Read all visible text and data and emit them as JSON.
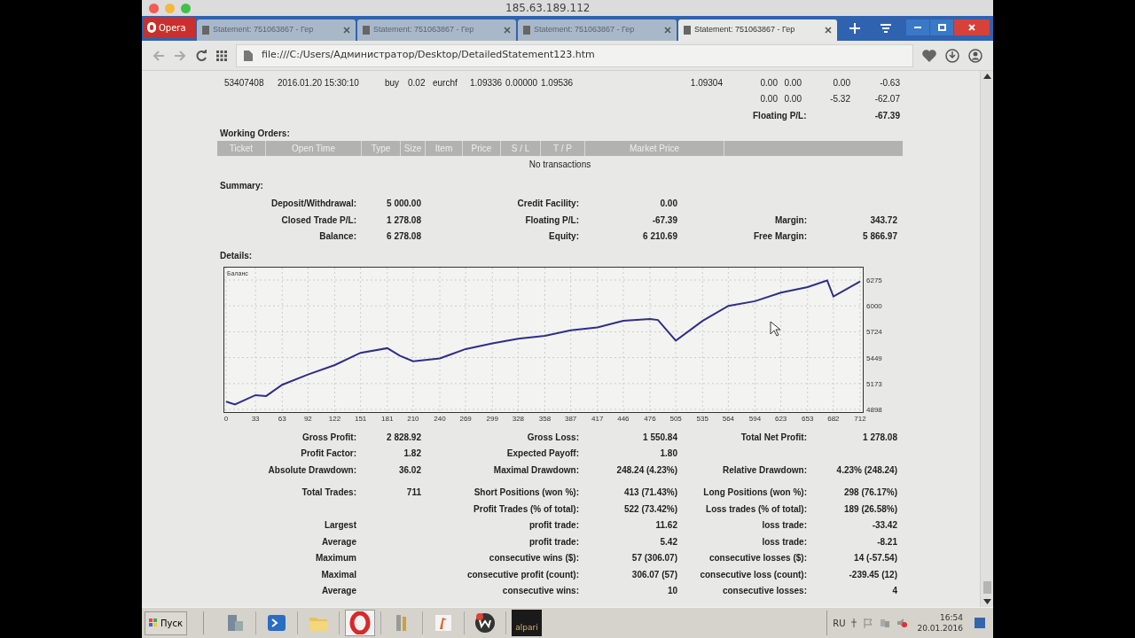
{
  "window": {
    "title": "185.63.189.112"
  },
  "browser": {
    "menu_label": "Opera",
    "tabs": [
      {
        "label": "Statement: 751063867 - Гер",
        "selected": false
      },
      {
        "label": "Statement: 751063867 - Гер",
        "selected": false
      },
      {
        "label": "Statement: 751063867 - Гер",
        "selected": false
      },
      {
        "label": "Statement: 751063867 - Гер",
        "selected": true
      }
    ],
    "address": "file:///C:/Users/Администратор/Desktop/DetailedStatement123.htm"
  },
  "open_trades": {
    "rows": [
      {
        "cells": [
          "53407408",
          "2016.01.20 15:30:10",
          "buy",
          "0.02",
          "eurchf",
          "1.09336",
          "0.00000",
          "1.09536",
          "1.09304",
          "0.00",
          "0.00",
          "0.00",
          "-0.63"
        ]
      }
    ],
    "totals": [
      "0.00",
      "0.00",
      "-5.32",
      "-62.07"
    ],
    "floating_label": "Floating P/L:",
    "floating_value": "-67.39"
  },
  "working_orders": {
    "title": "Working Orders:",
    "columns": [
      "Ticket",
      "Open Time",
      "Type",
      "Size",
      "Item",
      "Price",
      "S / L",
      "T / P",
      "Market Price"
    ],
    "empty_text": "No transactions"
  },
  "summary": {
    "title": "Summary:",
    "rows": [
      [
        {
          "label": "Deposit/Withdrawal:",
          "value": "5 000.00"
        },
        {
          "label": "Credit Facility:",
          "value": "0.00"
        },
        null
      ],
      [
        {
          "label": "Closed Trade P/L:",
          "value": "1 278.08"
        },
        {
          "label": "Floating P/L:",
          "value": "-67.39"
        },
        {
          "label": "Margin:",
          "value": "343.72"
        }
      ],
      [
        {
          "label": "Balance:",
          "value": "6 278.08"
        },
        {
          "label": "Equity:",
          "value": "6 210.69"
        },
        {
          "label": "Free Margin:",
          "value": "5 866.97"
        }
      ]
    ]
  },
  "details": {
    "title": "Details:",
    "chart_data": {
      "type": "line",
      "grid": true,
      "xlim": [
        0,
        712
      ],
      "ylim": [
        4898,
        6275
      ],
      "xticks": [
        0,
        33,
        63,
        92,
        122,
        151,
        181,
        210,
        240,
        269,
        299,
        328,
        358,
        387,
        417,
        446,
        476,
        505,
        535,
        564,
        594,
        623,
        653,
        682,
        712
      ],
      "yticks": [
        4898,
        5173,
        5449,
        5724,
        6000,
        6275
      ],
      "x": [
        0,
        10,
        33,
        45,
        63,
        92,
        122,
        151,
        181,
        195,
        210,
        240,
        269,
        299,
        328,
        358,
        387,
        417,
        446,
        476,
        485,
        505,
        535,
        564,
        594,
        623,
        653,
        675,
        682,
        712
      ],
      "series": [
        {
          "name": "Баланс",
          "color": "#2e2e8a",
          "values": [
            4980,
            4950,
            5050,
            5040,
            5160,
            5270,
            5370,
            5500,
            5550,
            5470,
            5410,
            5440,
            5540,
            5600,
            5650,
            5680,
            5740,
            5770,
            5840,
            5860,
            5850,
            5630,
            5840,
            6000,
            6050,
            6140,
            6200,
            6270,
            6100,
            6260
          ]
        }
      ]
    },
    "stats_groups": [
      {
        "rows": [
          [
            {
              "label": "Gross Profit:",
              "value": "2 828.92"
            },
            {
              "label": "Gross Loss:",
              "value": "1 550.84"
            },
            {
              "label": "Total Net Profit:",
              "value": "1 278.08"
            }
          ],
          [
            {
              "label": "Profit Factor:",
              "value": "1.82"
            },
            {
              "label": "Expected Payoff:",
              "value": "1.80"
            },
            null
          ],
          [
            {
              "label": "Absolute Drawdown:",
              "value": "36.02"
            },
            {
              "label": "Maximal Drawdown:",
              "value": "248.24 (4.23%)"
            },
            {
              "label": "Relative Drawdown:",
              "value": "4.23% (248.24)"
            }
          ]
        ]
      },
      {
        "rows": [
          [
            {
              "label": "Total Trades:",
              "value": "711"
            },
            {
              "label": "Short Positions (won %):",
              "value": "413 (71.43%)"
            },
            {
              "label": "Long Positions (won %):",
              "value": "298 (76.17%)"
            }
          ],
          [
            null,
            {
              "label": "Profit Trades (% of total):",
              "value": "522 (73.42%)"
            },
            {
              "label": "Loss trades (% of total):",
              "value": "189 (26.58%)"
            }
          ],
          [
            {
              "label": "Largest"
            },
            {
              "label": "profit trade:",
              "value": "11.62"
            },
            {
              "label": "loss trade:",
              "value": "-33.42"
            }
          ],
          [
            {
              "label": "Average"
            },
            {
              "label": "profit trade:",
              "value": "5.42"
            },
            {
              "label": "loss trade:",
              "value": "-8.21"
            }
          ],
          [
            {
              "label": "Maximum"
            },
            {
              "label": "consecutive wins ($):",
              "value": "57 (306.07)"
            },
            {
              "label": "consecutive losses ($):",
              "value": "14 (-57.54)"
            }
          ],
          [
            {
              "label": "Maximal"
            },
            {
              "label": "consecutive profit (count):",
              "value": "306.07 (57)"
            },
            {
              "label": "consecutive loss (count):",
              "value": "-239.45 (12)"
            }
          ],
          [
            {
              "label": "Average"
            },
            {
              "label": "consecutive wins:",
              "value": "10"
            },
            {
              "label": "consecutive losses:",
              "value": "4"
            }
          ]
        ]
      }
    ]
  },
  "taskbar": {
    "start_label": "Пуск",
    "app_label": "alpari",
    "language": "RU",
    "time": "16:54",
    "date": "20.01.2016"
  }
}
